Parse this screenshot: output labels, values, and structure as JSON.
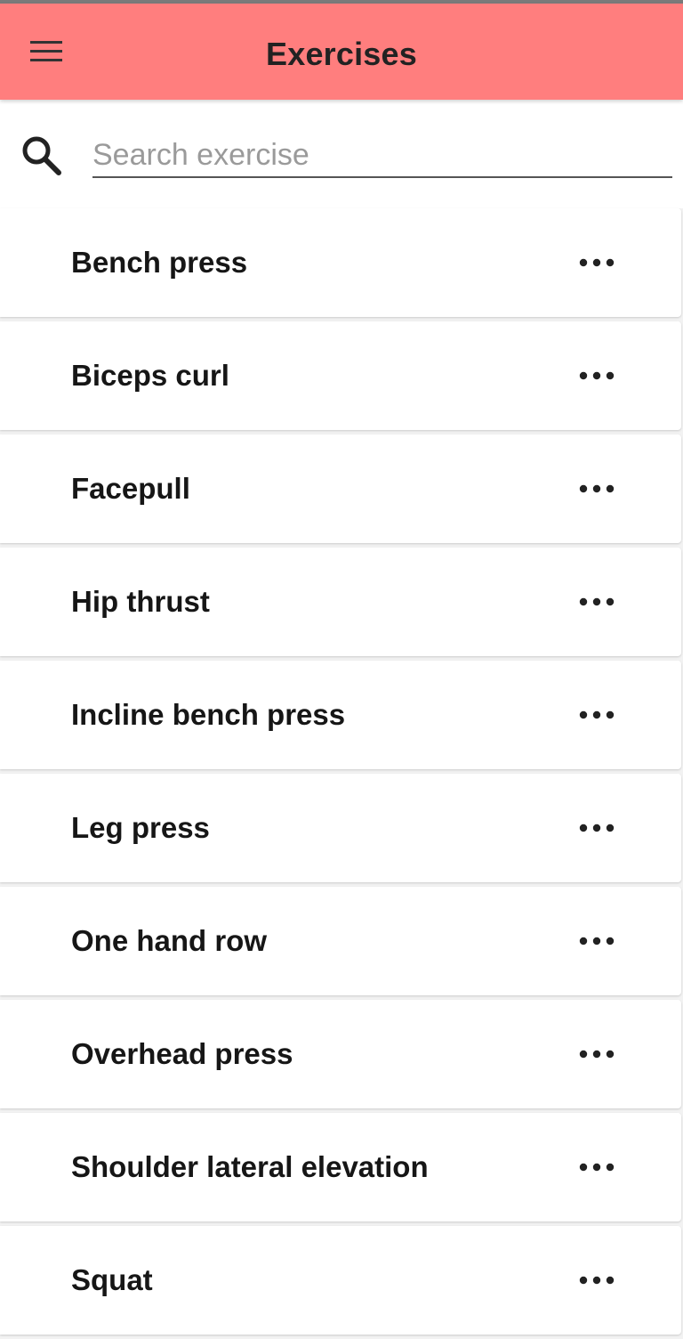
{
  "header": {
    "title": "Exercises",
    "menu_icon": "hamburger-menu-icon",
    "background_color": "#ff7e7e"
  },
  "search": {
    "icon": "search-icon",
    "placeholder": "Search exercise",
    "value": ""
  },
  "exercises": [
    {
      "label": "Bench press",
      "action_icon": "more-horizontal-icon"
    },
    {
      "label": "Biceps curl",
      "action_icon": "more-horizontal-icon"
    },
    {
      "label": "Facepull",
      "action_icon": "more-horizontal-icon"
    },
    {
      "label": "Hip thrust",
      "action_icon": "more-horizontal-icon"
    },
    {
      "label": "Incline bench press",
      "action_icon": "more-horizontal-icon"
    },
    {
      "label": "Leg press",
      "action_icon": "more-horizontal-icon"
    },
    {
      "label": "One hand row",
      "action_icon": "more-horizontal-icon"
    },
    {
      "label": "Overhead press",
      "action_icon": "more-horizontal-icon"
    },
    {
      "label": "Shoulder lateral elevation",
      "action_icon": "more-horizontal-icon"
    },
    {
      "label": "Squat",
      "action_icon": "more-horizontal-icon"
    }
  ]
}
